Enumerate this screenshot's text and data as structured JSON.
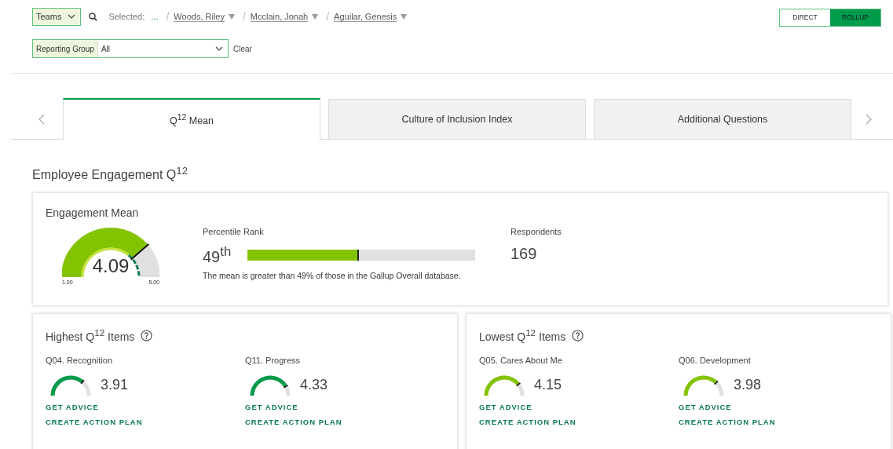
{
  "filters": {
    "team_select": "Teams",
    "selected_label": "Selected:",
    "ellipsis": "...",
    "breadcrumbs": [
      {
        "separator": "/",
        "name": "Woods, Riley"
      },
      {
        "separator": "/",
        "name": "Mcclain, Jonah"
      },
      {
        "separator": "/",
        "name": "Aguilar, Genesis"
      }
    ],
    "reporting_group_label": "Reporting Group",
    "reporting_group_value": "All",
    "clear": "Clear"
  },
  "view_toggle": [
    {
      "label": "DIRECT",
      "selected": false
    },
    {
      "label": "ROLLUP",
      "selected": true
    }
  ],
  "tabs": [
    {
      "label": "Q$^{12}$ Mean",
      "selected": true
    },
    {
      "label": "Culture of Inclusion Index",
      "selected": false
    },
    {
      "label": "Additional Questions",
      "selected": false
    }
  ],
  "heading": "Employee Engagement Q$^{12}$",
  "engagement": {
    "title": "Engagement Mean",
    "value": "4.09",
    "min": "1.00",
    "max": "5.00",
    "percentile_label": "Percentile Rank",
    "percentile": "49$^{th}$",
    "percentile_bar": {
      "level": 0.49
    },
    "note": "The mean is greater than 49% of those in the Gallup Overall database.",
    "respondents_label": "Respondents",
    "respondents": "169"
  },
  "sections": [
    {
      "kind": "highest",
      "title": "Highest Q$^{12}$ Items",
      "items": [
        {
          "name": "Q04. Recognition",
          "value": "3.91",
          "advice": "GET ADVICE",
          "plan": "CREATE ACTION PLAN"
        },
        {
          "name": "Q11. Progress",
          "value": "4.33",
          "advice": "GET ADVICE",
          "plan": "CREATE ACTION PLAN"
        }
      ]
    },
    {
      "kind": "lowest",
      "title": "Lowest Q$^{12}$ Items",
      "items": [
        {
          "name": "Q05. Cares About Me",
          "value": "4.15",
          "advice": "GET ADVICE",
          "plan": "CREATE ACTION PLAN"
        },
        {
          "name": "Q06. Development",
          "value": "3.98",
          "advice": "GET ADVICE",
          "plan": "CREATE ACTION PLAN"
        }
      ]
    }
  ]
}
